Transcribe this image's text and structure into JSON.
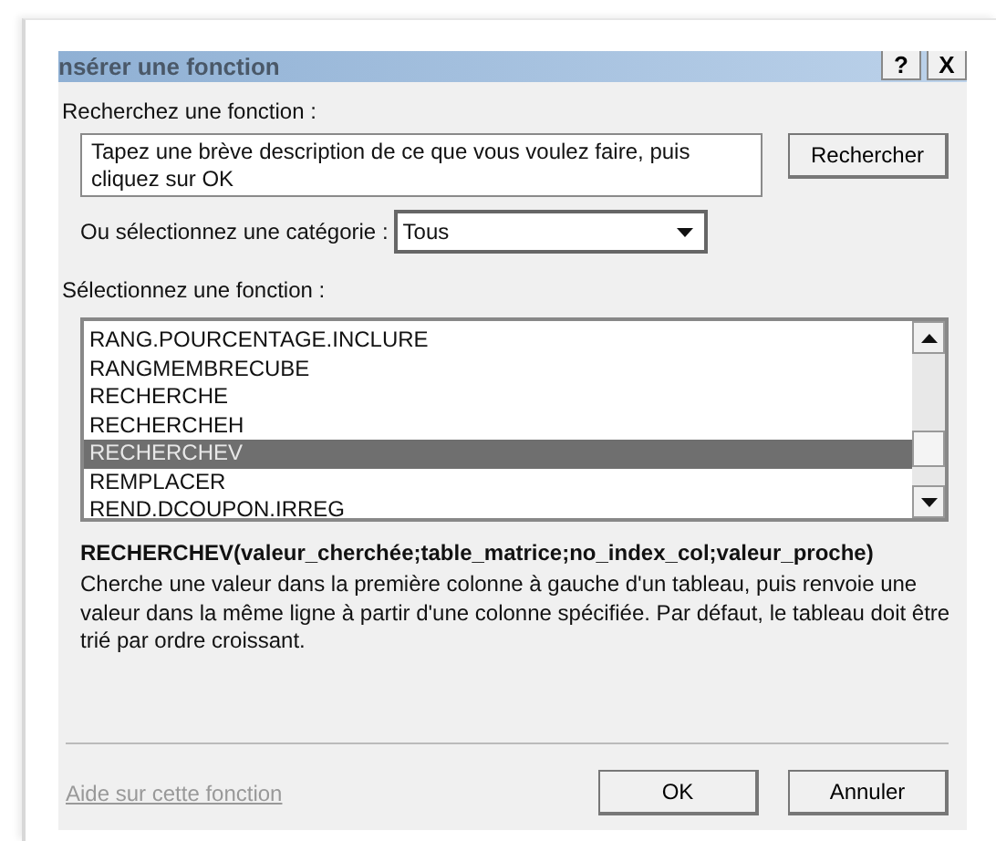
{
  "window": {
    "title": "nsérer une fonction",
    "title_buttons": [
      "?",
      "X"
    ]
  },
  "search": {
    "label": "Recherchez une fonction :",
    "value": "Tapez une brève description de ce que vous voulez faire, puis cliquez sur OK",
    "button": "Rechercher"
  },
  "category": {
    "label": "Ou sélectionnez une catégorie :",
    "value": "Tous"
  },
  "functions": {
    "label": "Sélectionnez une fonction :",
    "items": [
      {
        "name": "RANG.POURCENTAGE.INCLURE",
        "selected": false
      },
      {
        "name": "RANGMEMBRECUBE",
        "selected": false
      },
      {
        "name": "RECHERCHE",
        "selected": false
      },
      {
        "name": "RECHERCHEH",
        "selected": false
      },
      {
        "name": "RECHERCHEV",
        "selected": true
      },
      {
        "name": "REMPLACER",
        "selected": false
      },
      {
        "name": "REND.DCOUPON.IRREG",
        "selected": false
      }
    ]
  },
  "signature": "RECHERCHEV(valeur_cherchée;table_matrice;no_index_col;valeur_proche)",
  "description": "Cherche une valeur dans la première colonne à gauche d'un tableau, puis renvoie une valeur dans la même ligne à partir d'une colonne spécifiée. Par défaut, le tableau doit être trié par ordre croissant.",
  "help_link": "Aide sur cette fonction",
  "buttons": [
    "OK",
    "Annuler"
  ]
}
